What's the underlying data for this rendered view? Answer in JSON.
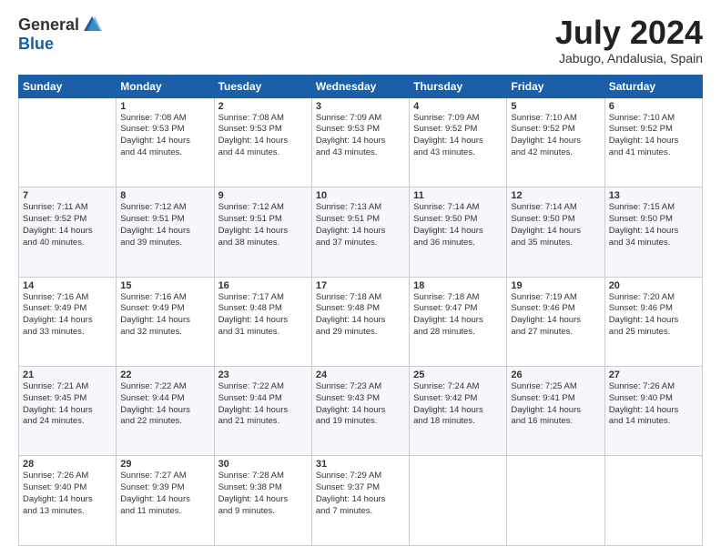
{
  "logo": {
    "general": "General",
    "blue": "Blue"
  },
  "header": {
    "title": "July 2024",
    "subtitle": "Jabugo, Andalusia, Spain"
  },
  "calendar": {
    "days": [
      "Sunday",
      "Monday",
      "Tuesday",
      "Wednesday",
      "Thursday",
      "Friday",
      "Saturday"
    ],
    "weeks": [
      [
        {
          "day": "",
          "lines": []
        },
        {
          "day": "1",
          "lines": [
            "Sunrise: 7:08 AM",
            "Sunset: 9:53 PM",
            "Daylight: 14 hours",
            "and 44 minutes."
          ]
        },
        {
          "day": "2",
          "lines": [
            "Sunrise: 7:08 AM",
            "Sunset: 9:53 PM",
            "Daylight: 14 hours",
            "and 44 minutes."
          ]
        },
        {
          "day": "3",
          "lines": [
            "Sunrise: 7:09 AM",
            "Sunset: 9:53 PM",
            "Daylight: 14 hours",
            "and 43 minutes."
          ]
        },
        {
          "day": "4",
          "lines": [
            "Sunrise: 7:09 AM",
            "Sunset: 9:52 PM",
            "Daylight: 14 hours",
            "and 43 minutes."
          ]
        },
        {
          "day": "5",
          "lines": [
            "Sunrise: 7:10 AM",
            "Sunset: 9:52 PM",
            "Daylight: 14 hours",
            "and 42 minutes."
          ]
        },
        {
          "day": "6",
          "lines": [
            "Sunrise: 7:10 AM",
            "Sunset: 9:52 PM",
            "Daylight: 14 hours",
            "and 41 minutes."
          ]
        }
      ],
      [
        {
          "day": "7",
          "lines": [
            "Sunrise: 7:11 AM",
            "Sunset: 9:52 PM",
            "Daylight: 14 hours",
            "and 40 minutes."
          ]
        },
        {
          "day": "8",
          "lines": [
            "Sunrise: 7:12 AM",
            "Sunset: 9:51 PM",
            "Daylight: 14 hours",
            "and 39 minutes."
          ]
        },
        {
          "day": "9",
          "lines": [
            "Sunrise: 7:12 AM",
            "Sunset: 9:51 PM",
            "Daylight: 14 hours",
            "and 38 minutes."
          ]
        },
        {
          "day": "10",
          "lines": [
            "Sunrise: 7:13 AM",
            "Sunset: 9:51 PM",
            "Daylight: 14 hours",
            "and 37 minutes."
          ]
        },
        {
          "day": "11",
          "lines": [
            "Sunrise: 7:14 AM",
            "Sunset: 9:50 PM",
            "Daylight: 14 hours",
            "and 36 minutes."
          ]
        },
        {
          "day": "12",
          "lines": [
            "Sunrise: 7:14 AM",
            "Sunset: 9:50 PM",
            "Daylight: 14 hours",
            "and 35 minutes."
          ]
        },
        {
          "day": "13",
          "lines": [
            "Sunrise: 7:15 AM",
            "Sunset: 9:50 PM",
            "Daylight: 14 hours",
            "and 34 minutes."
          ]
        }
      ],
      [
        {
          "day": "14",
          "lines": [
            "Sunrise: 7:16 AM",
            "Sunset: 9:49 PM",
            "Daylight: 14 hours",
            "and 33 minutes."
          ]
        },
        {
          "day": "15",
          "lines": [
            "Sunrise: 7:16 AM",
            "Sunset: 9:49 PM",
            "Daylight: 14 hours",
            "and 32 minutes."
          ]
        },
        {
          "day": "16",
          "lines": [
            "Sunrise: 7:17 AM",
            "Sunset: 9:48 PM",
            "Daylight: 14 hours",
            "and 31 minutes."
          ]
        },
        {
          "day": "17",
          "lines": [
            "Sunrise: 7:18 AM",
            "Sunset: 9:48 PM",
            "Daylight: 14 hours",
            "and 29 minutes."
          ]
        },
        {
          "day": "18",
          "lines": [
            "Sunrise: 7:18 AM",
            "Sunset: 9:47 PM",
            "Daylight: 14 hours",
            "and 28 minutes."
          ]
        },
        {
          "day": "19",
          "lines": [
            "Sunrise: 7:19 AM",
            "Sunset: 9:46 PM",
            "Daylight: 14 hours",
            "and 27 minutes."
          ]
        },
        {
          "day": "20",
          "lines": [
            "Sunrise: 7:20 AM",
            "Sunset: 9:46 PM",
            "Daylight: 14 hours",
            "and 25 minutes."
          ]
        }
      ],
      [
        {
          "day": "21",
          "lines": [
            "Sunrise: 7:21 AM",
            "Sunset: 9:45 PM",
            "Daylight: 14 hours",
            "and 24 minutes."
          ]
        },
        {
          "day": "22",
          "lines": [
            "Sunrise: 7:22 AM",
            "Sunset: 9:44 PM",
            "Daylight: 14 hours",
            "and 22 minutes."
          ]
        },
        {
          "day": "23",
          "lines": [
            "Sunrise: 7:22 AM",
            "Sunset: 9:44 PM",
            "Daylight: 14 hours",
            "and 21 minutes."
          ]
        },
        {
          "day": "24",
          "lines": [
            "Sunrise: 7:23 AM",
            "Sunset: 9:43 PM",
            "Daylight: 14 hours",
            "and 19 minutes."
          ]
        },
        {
          "day": "25",
          "lines": [
            "Sunrise: 7:24 AM",
            "Sunset: 9:42 PM",
            "Daylight: 14 hours",
            "and 18 minutes."
          ]
        },
        {
          "day": "26",
          "lines": [
            "Sunrise: 7:25 AM",
            "Sunset: 9:41 PM",
            "Daylight: 14 hours",
            "and 16 minutes."
          ]
        },
        {
          "day": "27",
          "lines": [
            "Sunrise: 7:26 AM",
            "Sunset: 9:40 PM",
            "Daylight: 14 hours",
            "and 14 minutes."
          ]
        }
      ],
      [
        {
          "day": "28",
          "lines": [
            "Sunrise: 7:26 AM",
            "Sunset: 9:40 PM",
            "Daylight: 14 hours",
            "and 13 minutes."
          ]
        },
        {
          "day": "29",
          "lines": [
            "Sunrise: 7:27 AM",
            "Sunset: 9:39 PM",
            "Daylight: 14 hours",
            "and 11 minutes."
          ]
        },
        {
          "day": "30",
          "lines": [
            "Sunrise: 7:28 AM",
            "Sunset: 9:38 PM",
            "Daylight: 14 hours",
            "and 9 minutes."
          ]
        },
        {
          "day": "31",
          "lines": [
            "Sunrise: 7:29 AM",
            "Sunset: 9:37 PM",
            "Daylight: 14 hours",
            "and 7 minutes."
          ]
        },
        {
          "day": "",
          "lines": []
        },
        {
          "day": "",
          "lines": []
        },
        {
          "day": "",
          "lines": []
        }
      ]
    ]
  }
}
